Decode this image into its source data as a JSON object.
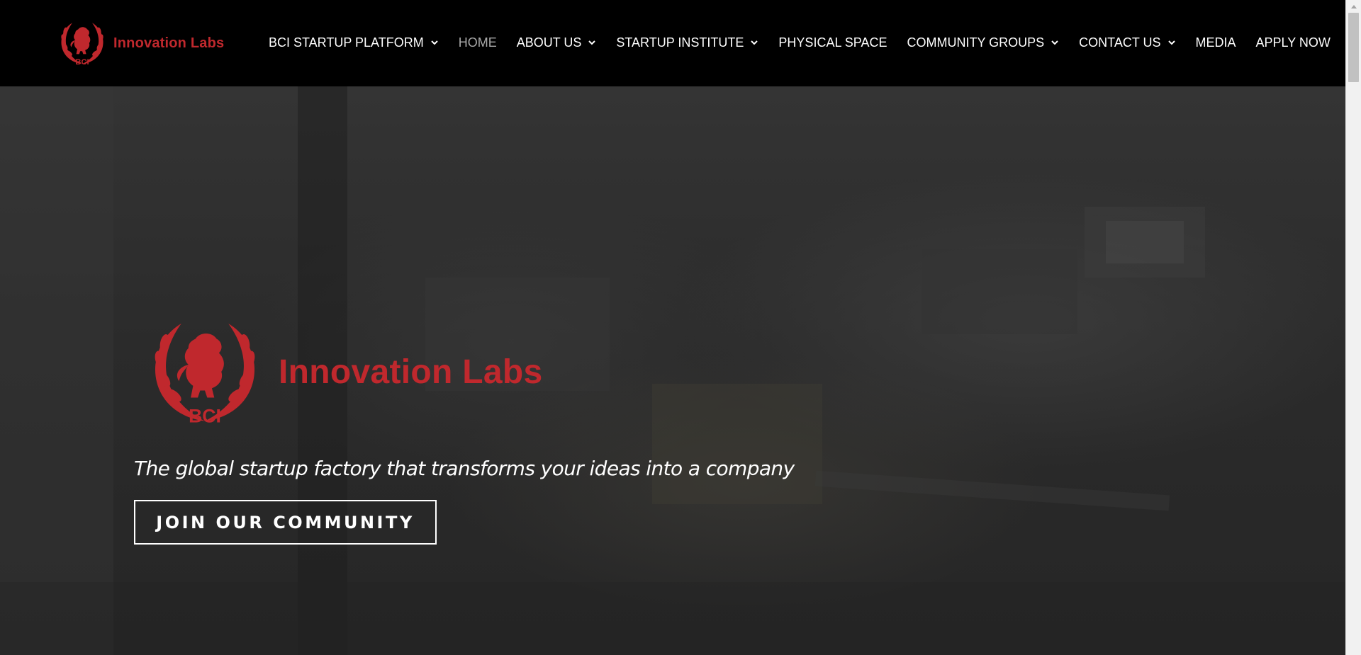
{
  "header": {
    "brand_name": "Innovation Labs",
    "crest_text": "BCI",
    "nav": [
      {
        "label": "BCI STARTUP PLATFORM",
        "has_dropdown": true
      },
      {
        "label": "HOME",
        "active": true
      },
      {
        "label": "ABOUT US",
        "has_dropdown": true
      },
      {
        "label": "STARTUP INSTITUTE",
        "has_dropdown": true
      },
      {
        "label": "PHYSICAL SPACE"
      },
      {
        "label": "COMMUNITY GROUPS",
        "has_dropdown": true
      },
      {
        "label": "CONTACT US",
        "has_dropdown": true
      },
      {
        "label": "MEDIA"
      },
      {
        "label": "APPLY NOW"
      }
    ]
  },
  "hero": {
    "brand_name": "Innovation Labs",
    "crest_text": "BCI",
    "tagline": "The global startup factory that transforms your ideas into a company",
    "cta_label": "JOIN OUR COMMUNITY"
  },
  "icons": {
    "crest": "lion-laurel-crest-icon",
    "dropdown": "chevron-down-icon"
  },
  "colors": {
    "brand_red": "#c0282d",
    "header_bg": "#000000",
    "nav_text": "#ffffff",
    "nav_active": "#a9a9a9"
  }
}
